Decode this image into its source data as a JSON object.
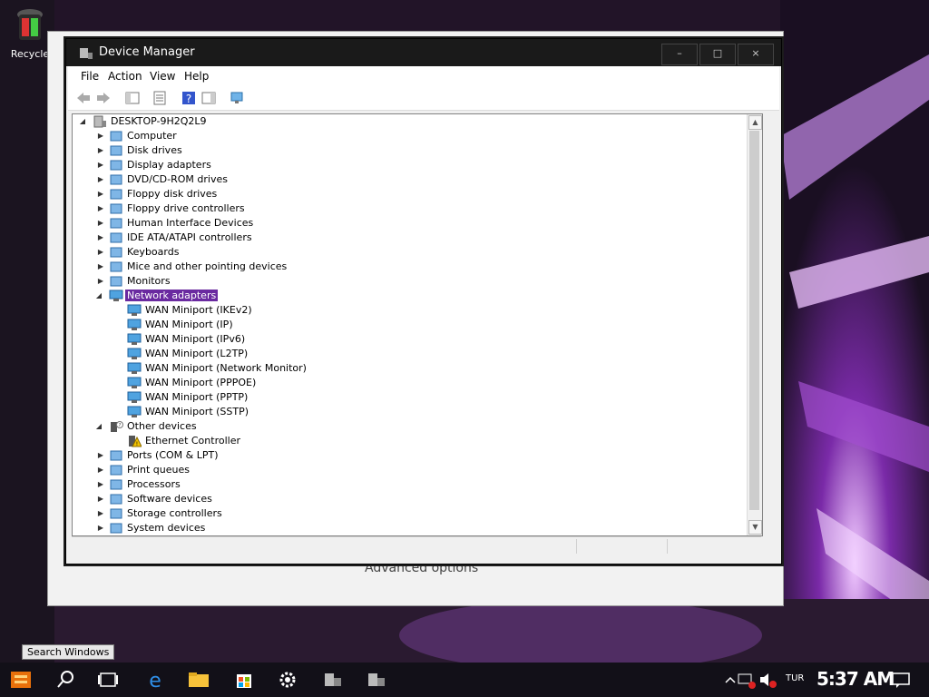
{
  "desktop": {
    "recycle_bin_label": "Recycle",
    "behind_window_text": "Advanced options"
  },
  "window": {
    "title": "Device Manager",
    "minimize_glyph": "–",
    "maximize_glyph": "□",
    "close_glyph": "×"
  },
  "menu": {
    "file": "File",
    "action": "Action",
    "view": "View",
    "help": "Help"
  },
  "tree": {
    "root": "DESKTOP-9H2Q2L9",
    "categories": [
      {
        "label": "Computer",
        "icon": "computer-icon"
      },
      {
        "label": "Disk drives",
        "icon": "disk-drive-icon"
      },
      {
        "label": "Display adapters",
        "icon": "display-adapter-icon"
      },
      {
        "label": "DVD/CD-ROM drives",
        "icon": "dvd-drive-icon"
      },
      {
        "label": "Floppy disk drives",
        "icon": "floppy-disk-icon"
      },
      {
        "label": "Floppy drive controllers",
        "icon": "floppy-controller-icon"
      },
      {
        "label": "Human Interface Devices",
        "icon": "hid-icon"
      },
      {
        "label": "IDE ATA/ATAPI controllers",
        "icon": "ide-controller-icon"
      },
      {
        "label": "Keyboards",
        "icon": "keyboard-icon"
      },
      {
        "label": "Mice and other pointing devices",
        "icon": "mouse-icon"
      },
      {
        "label": "Monitors",
        "icon": "monitor-icon"
      }
    ],
    "network_adapters": {
      "label": "Network adapters",
      "children": [
        "WAN Miniport (IKEv2)",
        "WAN Miniport (IP)",
        "WAN Miniport (IPv6)",
        "WAN Miniport (L2TP)",
        "WAN Miniport (Network Monitor)",
        "WAN Miniport (PPPOE)",
        "WAN Miniport (PPTP)",
        "WAN Miniport (SSTP)"
      ]
    },
    "other_devices": {
      "label": "Other devices",
      "children": [
        "Ethernet Controller"
      ]
    },
    "more_categories": [
      {
        "label": "Ports (COM & LPT)",
        "icon": "port-icon"
      },
      {
        "label": "Print queues",
        "icon": "printer-icon"
      },
      {
        "label": "Processors",
        "icon": "processor-icon"
      },
      {
        "label": "Software devices",
        "icon": "software-device-icon"
      },
      {
        "label": "Storage controllers",
        "icon": "storage-controller-icon"
      },
      {
        "label": "System devices",
        "icon": "system-device-icon"
      }
    ]
  },
  "taskbar": {
    "search_tooltip": "Search Windows",
    "language": "TUR",
    "time": "5:37 AM"
  },
  "colors": {
    "selection": "#6a2aa0",
    "accent_purple": "#9b4fd9"
  }
}
